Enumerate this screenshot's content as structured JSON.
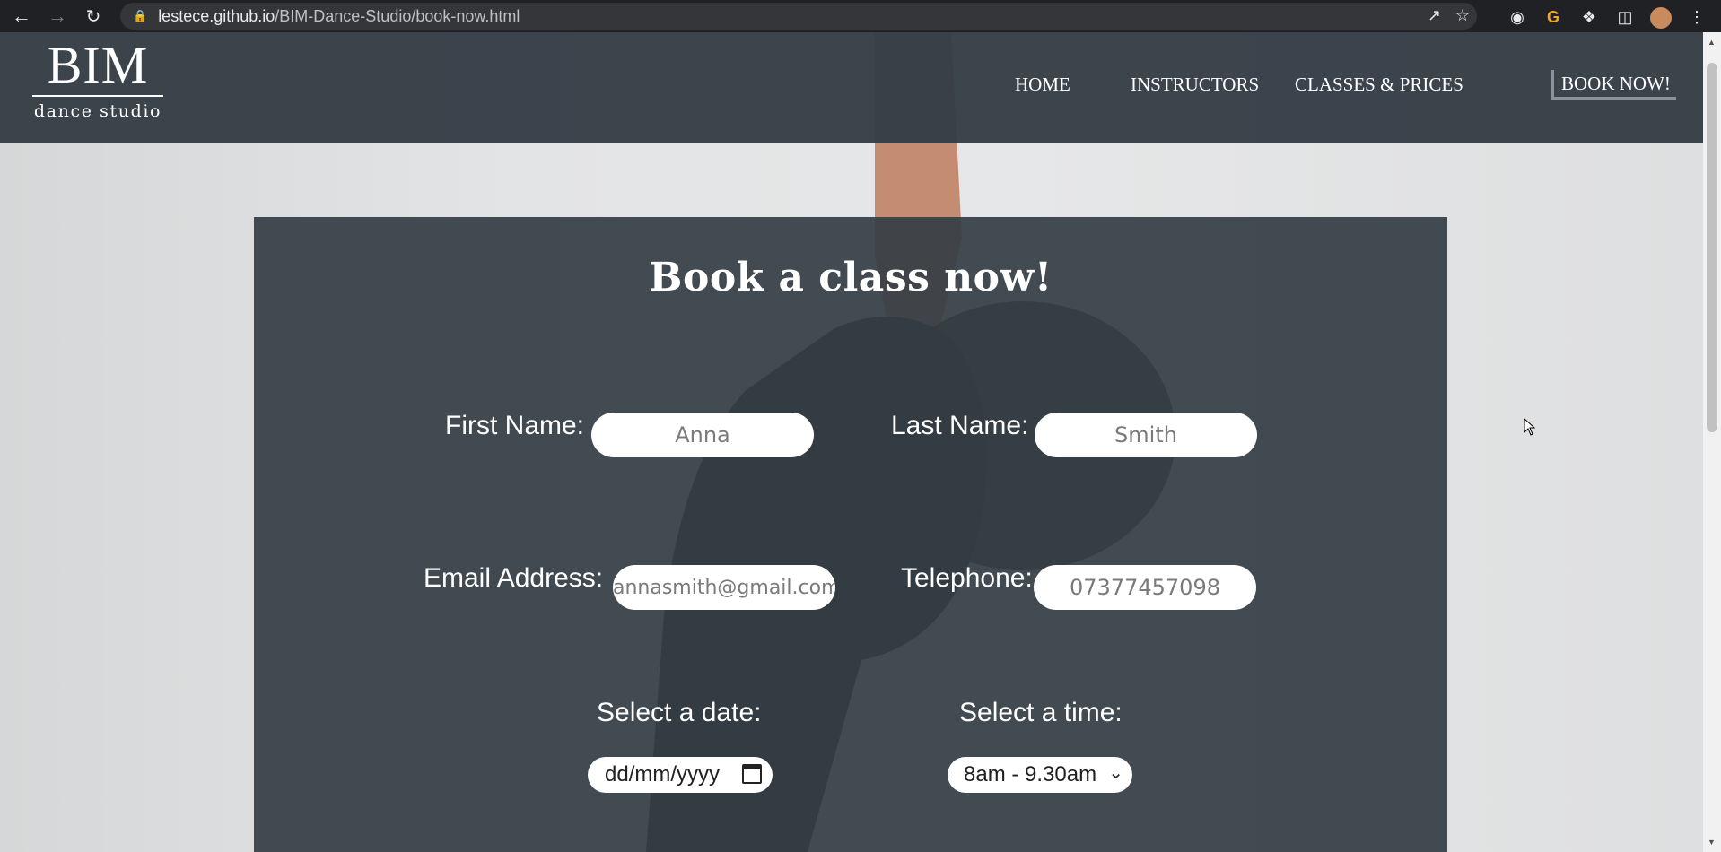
{
  "browser": {
    "url_host": "lestece.github.io",
    "url_path": "/BIM-Dance-Studio/book-now.html"
  },
  "header": {
    "logo_main": "BIM",
    "logo_sub": "dance studio",
    "nav": [
      "HOME",
      "INSTRUCTORS",
      "CLASSES & PRICES",
      "BOOK NOW!"
    ]
  },
  "form": {
    "title": "Book a class now!",
    "first_name_label": "First Name:",
    "first_name_placeholder": "Anna",
    "last_name_label": "Last Name:",
    "last_name_placeholder": "Smith",
    "email_label": "Email Address:",
    "email_placeholder": "annasmith@gmail.com",
    "telephone_label": "Telephone:",
    "telephone_placeholder": "07377457098",
    "date_label": "Select a date:",
    "date_value": "dd/mm/yyyy",
    "time_label": "Select a time:",
    "time_value": "8am - 9.30am"
  }
}
